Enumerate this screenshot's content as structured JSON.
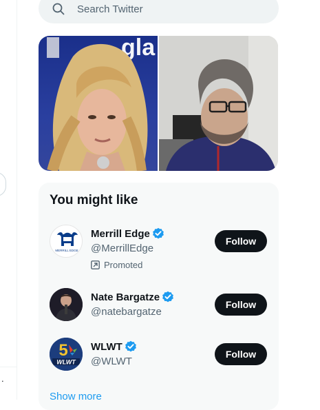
{
  "search": {
    "placeholder": "Search Twitter",
    "icon": "search-icon"
  },
  "media": {
    "images": [
      "photo-left",
      "photo-right"
    ],
    "logo_text": "gla"
  },
  "who_to_follow": {
    "title": "You might like",
    "users": [
      {
        "name": "Merrill Edge",
        "handle": "@MerrillEdge",
        "verified": true,
        "promoted": "Promoted",
        "follow_label": "Follow",
        "avatar_caption": "MERRILL EDGE"
      },
      {
        "name": "Nate Bargatze",
        "handle": "@natebargatze",
        "verified": true,
        "follow_label": "Follow"
      },
      {
        "name": "WLWT",
        "handle": "@WLWT",
        "verified": true,
        "follow_label": "Follow",
        "avatar_caption": "WLWT",
        "avatar_number": "5"
      }
    ],
    "show_more": "Show more"
  },
  "left_rail": {
    "dots": "."
  },
  "colors": {
    "accent": "#1d9bf0",
    "button_bg": "#0f1419",
    "panel_bg": "#f7f9f9",
    "secondary_text": "#536471"
  }
}
